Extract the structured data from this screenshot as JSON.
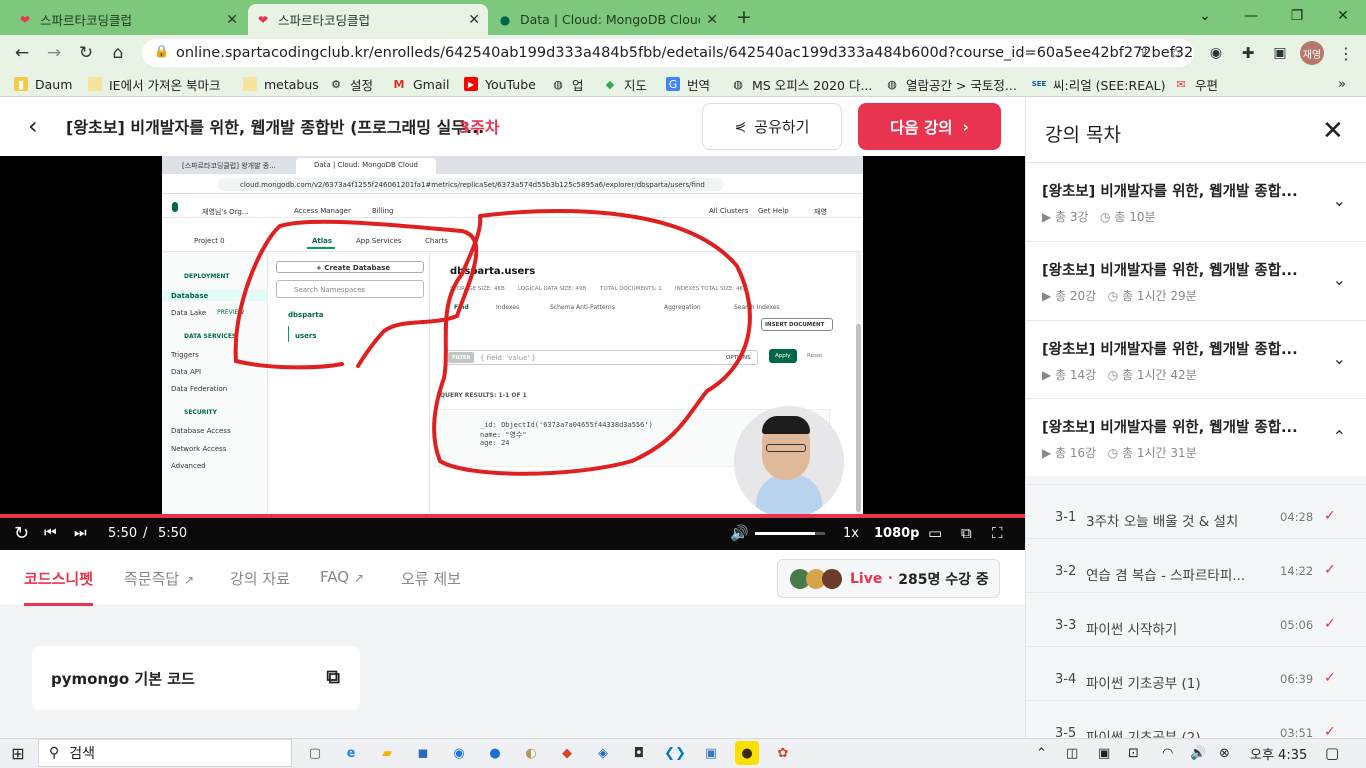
{
  "browser": {
    "tabs": [
      {
        "title": "스파르타코딩클럽",
        "icon": "heart-logo-icon"
      },
      {
        "title": "스파르타코딩클럽",
        "icon": "heart-logo-icon"
      },
      {
        "title": "Data | Cloud: MongoDB Cloud",
        "icon": "mongodb-leaf-icon"
      }
    ],
    "new_tab": "+",
    "url": "online.spartacodingclub.kr/enrolleds/642540ab199d333a484b5fbb/edetails/642540ac199d333a484b600d?course_id=60a5ee42bf272bef32a58fb9",
    "profile": "재영",
    "bookmarks": [
      "Daum",
      "IE에서 가져온 북마크",
      "metabus",
      "설정",
      "Gmail",
      "YouTube",
      "업",
      "지도",
      "번역",
      "MS 오피스 2020 다...",
      "열람공간 > 국토정...",
      "씨:리얼 (SEE:REAL)",
      "우편"
    ]
  },
  "header": {
    "title": "[왕초보] 비개발자를 위한, 웹개발 종합반 (프로그래밍 실무...",
    "week": "3주차",
    "share_label": "공유하기",
    "next_label": "다음 강의"
  },
  "player": {
    "current_time": "5:50",
    "separator": "/",
    "duration": "5:50",
    "speed": "1x",
    "quality": "1080p",
    "progress": 1.0,
    "volume": 0.85
  },
  "inner_screen": {
    "tabs": [
      "[스파르타코딩클럽] 왕개발 종...",
      "Data | Cloud: MongoDB Cloud"
    ],
    "url": "cloud.mongodb.com/v2/6373a4f1255f246061201fa1#metrics/replicaSet/6373a574d55b3b125c5895a6/explorer/dbsparta/users/find",
    "org": "재영님's Org...",
    "access_manager": "Access Manager",
    "billing": "Billing",
    "all_clusters": "All Clusters",
    "get_help": "Get Help",
    "user": "재영",
    "project": "Project 0",
    "nav_tabs": [
      "Atlas",
      "App Services",
      "Charts"
    ],
    "deployment": "DEPLOYMENT",
    "database": "Database",
    "data_lake": "Data Lake",
    "preview": "PREVIEW",
    "data_services": "DATA SERVICES",
    "triggers": "Triggers",
    "data_api": "Data API",
    "data_federation": "Data Federation",
    "security": "SECURITY",
    "database_access": "Database Access",
    "network_access": "Network Access",
    "advanced": "Advanced",
    "create_db": "+ Create Database",
    "search_ns": "Search Namespaces",
    "db_name": "dbsparta",
    "coll_name": "users",
    "coll_title": "dbsparta.users",
    "stats": [
      "STORAGE SIZE: 4KB",
      "LOGICAL DATA SIZE: 49B",
      "TOTAL DOCUMENTS: 1",
      "INDEXES TOTAL SIZE: 4KB"
    ],
    "sub_tabs": [
      "Find",
      "Indexes",
      "Schema Anti-Patterns",
      "Aggregation",
      "Search Indexes"
    ],
    "insert_doc": "INSERT DOCUMENT",
    "filter": "FILTER",
    "filter_placeholder": "{ field: 'value' }",
    "options": "OPTIONS",
    "apply": "Apply",
    "reset": "Reset",
    "query_results": "QUERY RESULTS: 1-1 OF 1",
    "doc_id": "_id: ObjectId('6373a7a04655f44338d3a556')",
    "doc_name": "name: \"영수\"",
    "doc_age": "age: 24"
  },
  "tabs": [
    {
      "label": "코드스니펫",
      "active": true
    },
    {
      "label": "즉문즉답",
      "external": true
    },
    {
      "label": "강의 자료"
    },
    {
      "label": "FAQ",
      "external": true
    },
    {
      "label": "오류 제보"
    }
  ],
  "live": {
    "label": "Live",
    "dot": "•",
    "count": "285명 수강 중"
  },
  "snippet": {
    "title": "pymongo 기본 코드"
  },
  "sidebar": {
    "title": "강의 목차",
    "sections": [
      {
        "title": "[왕초보] 비개발자를 위한, 웹개발 종합...",
        "count": "총 3강",
        "time": "총 10분",
        "expanded": false
      },
      {
        "title": "[왕초보] 비개발자를 위한, 웹개발 종합...",
        "count": "총 20강",
        "time": "총 1시간 29분",
        "expanded": false
      },
      {
        "title": "[왕초보] 비개발자를 위한, 웹개발 종합...",
        "count": "총 14강",
        "time": "총 1시간 42분",
        "expanded": false
      },
      {
        "title": "[왕초보] 비개발자를 위한, 웹개발 종합...",
        "count": "총 16강",
        "time": "총 1시간 31분",
        "expanded": true
      }
    ],
    "lectures": [
      {
        "num": "3-1",
        "title": "3주차 오늘 배울 것 & 설치",
        "duration": "04:28",
        "done": true
      },
      {
        "num": "3-2",
        "title": "연습 겸 복습 - 스파르타피...",
        "duration": "14:22",
        "done": true
      },
      {
        "num": "3-3",
        "title": "파이썬 시작하기",
        "duration": "05:06",
        "done": true
      },
      {
        "num": "3-4",
        "title": "파이썬 기초공부 (1)",
        "duration": "06:39",
        "done": true
      },
      {
        "num": "3-5",
        "title": "파이썬 기초공부 (2)",
        "duration": "03:51",
        "done": true
      }
    ]
  },
  "taskbar": {
    "search_label": "검색",
    "time": "오후 4:35"
  },
  "colors": {
    "accent": "#e8344e",
    "browser_frame": "#7dc87c",
    "mongo_green": "#00684a"
  }
}
